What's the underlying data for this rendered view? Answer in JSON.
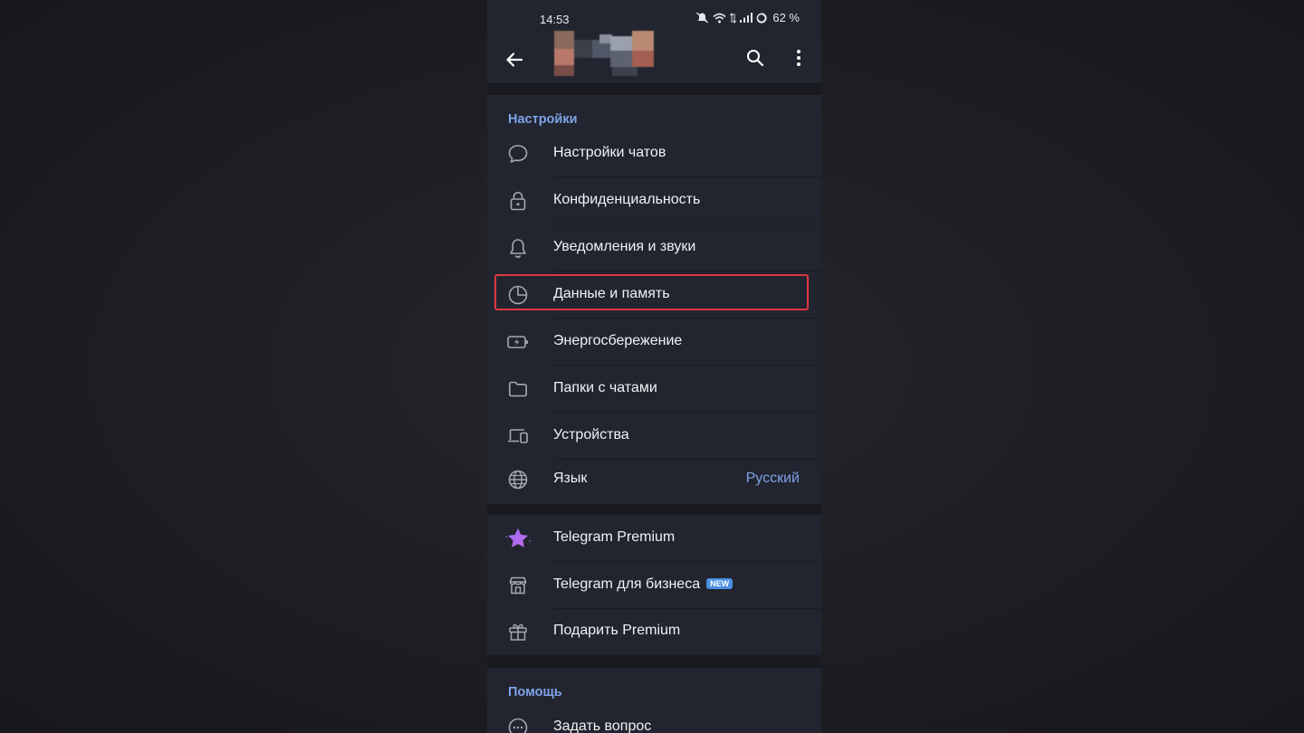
{
  "status_bar": {
    "time": "14:53",
    "battery": "62 %"
  },
  "app_bar": {
    "back_icon": "arrow-left-icon",
    "search_icon": "search-icon",
    "more_icon": "more-vertical-icon"
  },
  "settings_section": {
    "title": "Настройки",
    "items": [
      {
        "label": "Настройки чатов",
        "icon": "chat-bubble-icon"
      },
      {
        "label": "Конфиденциальность",
        "icon": "lock-icon"
      },
      {
        "label": "Уведомления и звуки",
        "icon": "bell-icon"
      },
      {
        "label": "Данные и память",
        "icon": "pie-chart-icon"
      },
      {
        "label": "Энергосбережение",
        "icon": "battery-bolt-icon"
      },
      {
        "label": "Папки с чатами",
        "icon": "folder-icon"
      },
      {
        "label": "Устройства",
        "icon": "devices-icon"
      },
      {
        "label": "Язык",
        "icon": "globe-icon",
        "value": "Русский"
      }
    ]
  },
  "premium_section": {
    "items": [
      {
        "label": "Telegram Premium",
        "icon": "premium-star-icon"
      },
      {
        "label": "Telegram для бизнеса",
        "icon": "store-icon",
        "badge": "NEW"
      },
      {
        "label": "Подарить Premium",
        "icon": "gift-icon"
      }
    ]
  },
  "help_section": {
    "title": "Помощь",
    "items": [
      {
        "label": "Задать вопрос",
        "icon": "question-bubble-icon"
      }
    ]
  },
  "colors": {
    "accent": "#7fa2e8",
    "surface": "#22252f",
    "highlight_border": "#e0373f",
    "badge": "#4a90e2"
  }
}
